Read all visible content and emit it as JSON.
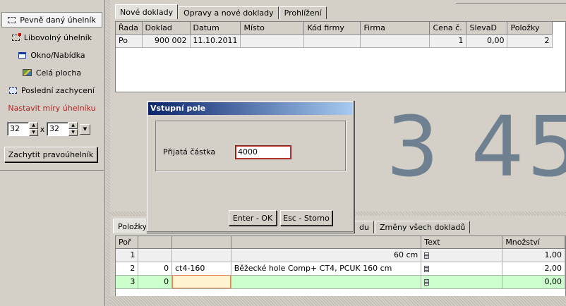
{
  "capture_panel": {
    "modes": [
      {
        "label": "Pevně daný úhelník",
        "icon": "fixed-rect-icon",
        "active": true
      },
      {
        "label": "Libovolný úhelník",
        "icon": "free-rect-icon",
        "active": false
      },
      {
        "label": "Okno/Nabídka",
        "icon": "window-icon",
        "active": false
      },
      {
        "label": "Celá plocha",
        "icon": "desktop-icon",
        "active": false
      },
      {
        "label": "Poslední zachycení",
        "icon": "last-capture-icon",
        "active": false
      }
    ],
    "size_title": "Nastavit míry úhelníku",
    "width_value": "32",
    "height_value": "32",
    "times_sign": "x",
    "grab_button": "Zachytit pravoúhelník",
    "title_color": "#b22222"
  },
  "top_tabs": [
    "Nové doklady",
    "Opravy a nové doklady",
    "Prohlížení"
  ],
  "docs_table": {
    "headers": [
      "Řada",
      "Doklad",
      "Datum",
      "Místo",
      "Kód firmy",
      "Firma",
      "Cena č.",
      "SlevaD",
      "Položky"
    ],
    "rows": [
      [
        "Po",
        "900 002",
        "11.10.2011",
        "",
        "",
        "",
        "1",
        "0,00",
        "2"
      ]
    ]
  },
  "big_display": "3 45",
  "bottom_tabs": [
    "Položky",
    "du",
    "Změny všech dokladů"
  ],
  "items_table": {
    "headers": [
      "Poř",
      "",
      "",
      "",
      "Text",
      "Množství"
    ],
    "rows": [
      {
        "no": "1",
        "qty_code": "",
        "code": "",
        "name": "60 cm",
        "amount": "1,00"
      },
      {
        "no": "2",
        "qty_code": "0",
        "code": "ct4-160",
        "name": "Běžecké hole Comp+ CT4, PCUK 160 cm",
        "amount": "2,00"
      },
      {
        "no": "3",
        "qty_code": "0",
        "code": "",
        "name": "",
        "amount": "0,00"
      }
    ]
  },
  "dialog": {
    "title": "Vstupní pole",
    "field_label": "Přijatá částka",
    "field_value": "4000",
    "ok_button": "Enter - OK",
    "cancel_button": "Esc - Storno"
  },
  "colors": {
    "title_bar_start": "#0a246a",
    "new_row_bg": "#ccffcc",
    "big_number": "#6f8090"
  }
}
